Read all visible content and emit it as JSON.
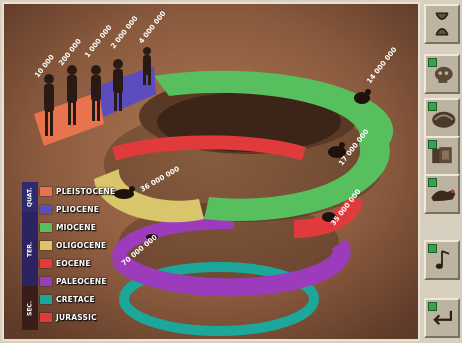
{
  "figure": {
    "time_labels": [
      "10 000",
      "200 000",
      "1 000 000",
      "2 000 000",
      "4 000 000",
      "14 000 000",
      "17 000 000",
      "35 000 000",
      "36 000 000",
      "70 000 000"
    ]
  },
  "legend": {
    "era_labels": [
      "QUAT.",
      "TER.",
      "SEC."
    ],
    "periods": [
      {
        "label": "PLEISTOCENE",
        "color": "#e8734f"
      },
      {
        "label": "PLIOCENE",
        "color": "#5b4cc0"
      },
      {
        "label": "MIOCENE",
        "color": "#58bf5e"
      },
      {
        "label": "OLIGOCENE",
        "color": "#d9c56a"
      },
      {
        "label": "EOCENE",
        "color": "#e13a3a"
      },
      {
        "label": "PALEOCENE",
        "color": "#9c3bbb"
      },
      {
        "label": "CRETACE",
        "color": "#1ba89a"
      },
      {
        "label": "JURASSIC",
        "color": "#e23a3a"
      }
    ]
  },
  "toolbar": {
    "buttons": [
      {
        "icon": "hourglass-icon"
      },
      {
        "icon": "skull-icon"
      },
      {
        "icon": "fossil-icon"
      },
      {
        "icon": "rock-cards-icon"
      },
      {
        "icon": "animals-icon"
      },
      {
        "icon": "music-note-icon"
      },
      {
        "icon": "return-arrow-icon"
      }
    ]
  }
}
